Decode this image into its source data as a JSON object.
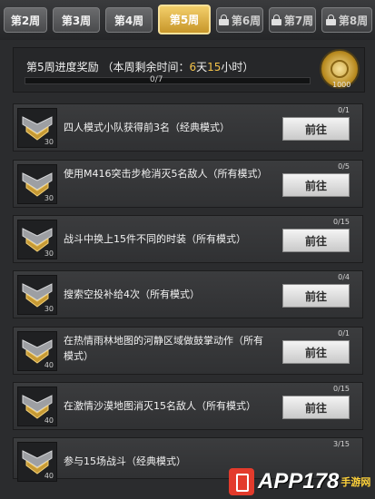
{
  "tabs": [
    {
      "label": "第2周",
      "locked": false,
      "active": false
    },
    {
      "label": "第3周",
      "locked": false,
      "active": false
    },
    {
      "label": "第4周",
      "locked": false,
      "active": false
    },
    {
      "label": "第5周",
      "locked": false,
      "active": true
    },
    {
      "label": "第6周",
      "locked": true,
      "active": false
    },
    {
      "label": "第7周",
      "locked": true,
      "active": false
    },
    {
      "label": "第8周",
      "locked": true,
      "active": false
    }
  ],
  "progress": {
    "title_prefix": "第5周进度奖励",
    "remaining_prefix": "（本周剩余时间：",
    "days": "6",
    "days_unit": "天",
    "hours": "15",
    "hours_unit": "小时）",
    "count": "0/7",
    "fraction": 0,
    "reward_amount": "1000"
  },
  "tasks": [
    {
      "text": "四人模式小队获得前3名（经典模式）",
      "progress": "0/1",
      "badge_value": "30",
      "button": "前往"
    },
    {
      "text": "使用M416突击步枪消灭5名敌人（所有模式）",
      "progress": "0/5",
      "badge_value": "30",
      "button": "前往"
    },
    {
      "text": "战斗中换上15件不同的时装（所有模式）",
      "progress": "0/15",
      "badge_value": "30",
      "button": "前往"
    },
    {
      "text": "搜索空投补给4次（所有模式）",
      "progress": "0/4",
      "badge_value": "30",
      "button": "前往"
    },
    {
      "text": "在热情雨林地图的河静区域做鼓掌动作（所有模式）",
      "progress": "0/1",
      "badge_value": "40",
      "button": "前往"
    },
    {
      "text": "在激情沙漠地图消灭15名敌人（所有模式）",
      "progress": "0/15",
      "badge_value": "40",
      "button": "前往"
    },
    {
      "text": "参与15场战斗（经典模式）",
      "progress": "3/15",
      "badge_value": "40",
      "button": ""
    }
  ],
  "watermark": {
    "text": "APP178",
    "sub": "手游网"
  },
  "colors": {
    "accent": "#f3c24a",
    "button": "#dcdcdc",
    "panel": "#343537"
  },
  "icons": {
    "locked_tab": "lock-icon",
    "reward": "coin-icon",
    "task_badge": "rank-chevron-icon"
  }
}
